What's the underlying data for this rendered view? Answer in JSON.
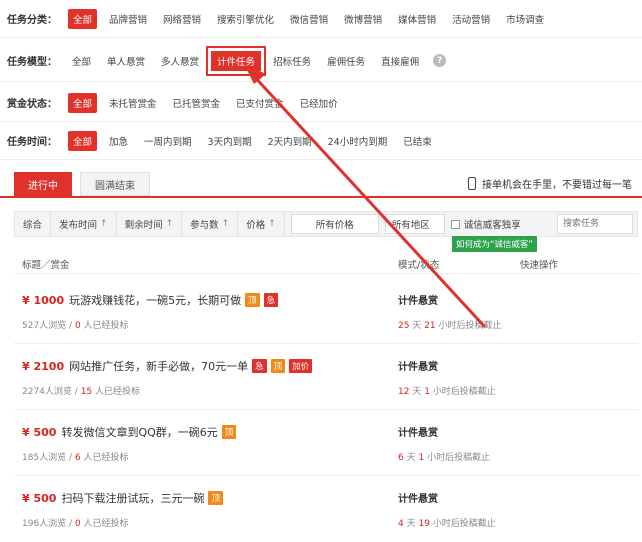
{
  "filters": [
    {
      "label": "任务分类：",
      "options": [
        "全部",
        "品牌营销",
        "网络营销",
        "搜索引擎优化",
        "微信营销",
        "微博营销",
        "媒体营销",
        "活动营销",
        "市场调查"
      ],
      "active": 0
    },
    {
      "label": "任务模型：",
      "options": [
        "全部",
        "单人悬赏",
        "多人悬赏",
        "计件任务",
        "招标任务",
        "雇佣任务",
        "直接雇佣"
      ],
      "active": 3
    },
    {
      "label": "赏金状态：",
      "options": [
        "全部",
        "未托管赏金",
        "已托管赏金",
        "已支付赏金",
        "已经加价"
      ],
      "active": 0
    },
    {
      "label": "任务时间：",
      "options": [
        "全部",
        "加急",
        "一周内到期",
        "3天内到期",
        "2天内到期",
        "24小时内到期",
        "已结束"
      ],
      "active": 0
    }
  ],
  "help_icon": "question-icon",
  "tabs": {
    "active": "进行中",
    "inactive": "圆满结束"
  },
  "phone_note": "接单机会在手里，不要错过每一笔",
  "sort_bar": {
    "items": [
      "综合",
      "发布时间",
      "剩余时间",
      "参与数",
      "价格"
    ],
    "price_select": "所有价格",
    "region_select": "所有地区",
    "checkbox_label": "诚信威客独享",
    "search_placeholder": "搜索任务",
    "tooltip": "如何成为“诚信威客”"
  },
  "list_head": {
    "col1": "标题／赏金",
    "col2": "模式/状态",
    "col3": "快速操作"
  },
  "tasks": [
    {
      "price": "¥ 1000",
      "title": "玩游戏赚钱花，一碗5元，长期可做",
      "badges": [
        [
          "顶",
          "orange"
        ],
        [
          "急",
          "red"
        ]
      ],
      "views": "527人浏览 /",
      "bids": "0",
      "bids_suffix": " 人已经投标",
      "mode": "计件悬赏",
      "days": "25",
      "hours": "21",
      "deadline_a": " 天 ",
      "deadline_b": " 小时后投稿截止"
    },
    {
      "price": "¥ 2100",
      "title": "网站推广任务，新手必做，70元一单",
      "badges": [
        [
          "急",
          "red"
        ],
        [
          "顶",
          "orange"
        ],
        [
          "加价",
          "red"
        ]
      ],
      "views": "2274人浏览 /",
      "bids": "15",
      "bids_suffix": " 人已经投标",
      "mode": "计件悬赏",
      "days": "12",
      "hours": "1",
      "deadline_a": " 天 ",
      "deadline_b": " 小时后投稿截止"
    },
    {
      "price": "¥ 500",
      "title": "转发微信文章到QQ群，一碗6元",
      "badges": [
        [
          "顶",
          "orange"
        ]
      ],
      "views": "185人浏览 /",
      "bids": "6",
      "bids_suffix": " 人已经投标",
      "mode": "计件悬赏",
      "days": "6",
      "hours": "1",
      "deadline_a": " 天 ",
      "deadline_b": " 小时后投稿截止"
    },
    {
      "price": "¥ 500",
      "title": "扫码下载注册试玩，三元一碗",
      "badges": [
        [
          "顶",
          "orange"
        ]
      ],
      "views": "196人浏览 /",
      "bids": "0",
      "bids_suffix": " 人已经投标",
      "mode": "计件悬赏",
      "days": "4",
      "hours": "19",
      "deadline_a": " 天 ",
      "deadline_b": " 小时后投稿截止"
    }
  ],
  "colors": {
    "accent": "#e0312b",
    "price": "#d8231f",
    "badge_orange": "#f08a1a",
    "tooltip_green": "#2da24b"
  }
}
